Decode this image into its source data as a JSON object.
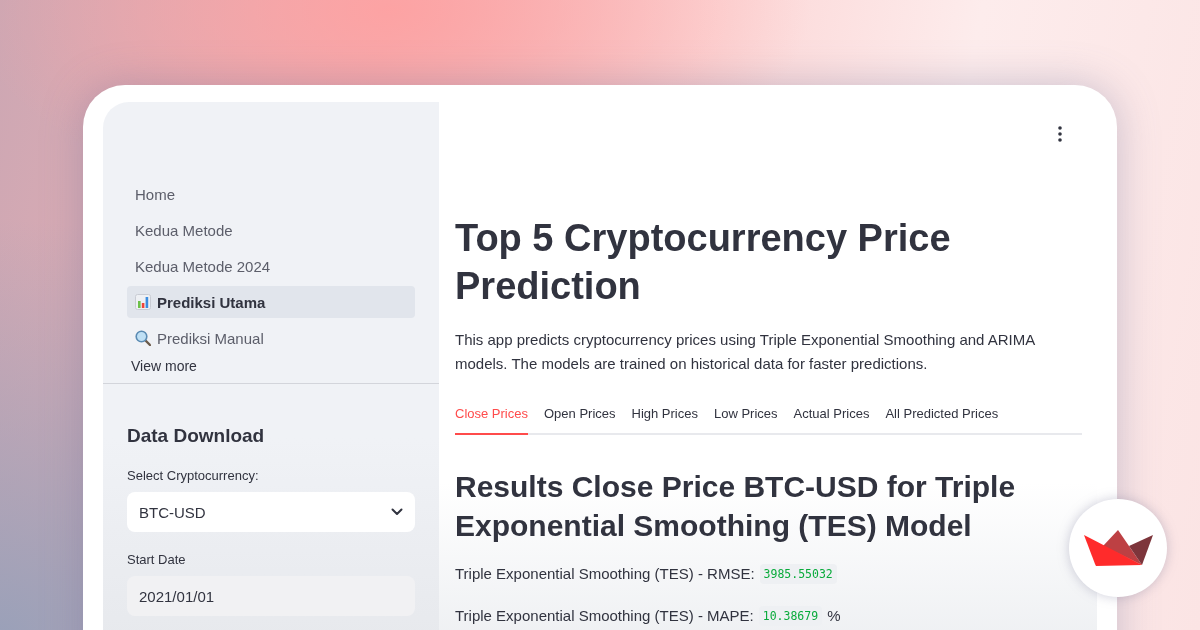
{
  "sidebar": {
    "nav_items": [
      {
        "label": "Home",
        "kind": "plain",
        "selected": false
      },
      {
        "label": "Kedua Metode",
        "kind": "plain",
        "selected": false
      },
      {
        "label": "Kedua Metode 2024",
        "kind": "plain",
        "selected": false
      },
      {
        "label": "Prediksi Utama",
        "kind": "chart",
        "selected": true
      },
      {
        "label": "Prediksi Manual",
        "kind": "search",
        "selected": false
      }
    ],
    "view_more": "View more",
    "section_title": "Data Download",
    "fields": [
      {
        "kind": "select",
        "label": "Select Cryptocurrency:",
        "value": "BTC-USD"
      },
      {
        "kind": "date",
        "label": "Start Date",
        "value": "2021/01/01"
      }
    ]
  },
  "main": {
    "title": "Top 5 Cryptocurrency Price Prediction",
    "description": "This app predicts cryptocurrency prices using Triple Exponential Smoothing and ARIMA models. The models are trained on historical data for faster predictions.",
    "tabs": [
      {
        "label": "Close Prices",
        "selected": true
      },
      {
        "label": "Open Prices",
        "selected": false
      },
      {
        "label": "High Prices",
        "selected": false
      },
      {
        "label": "Low Prices",
        "selected": false
      },
      {
        "label": "Actual Prices",
        "selected": false
      },
      {
        "label": "All Predicted Prices",
        "selected": false
      }
    ],
    "result_heading": "Results Close Price BTC-USD for Triple Exponential Smoothing (TES) Model",
    "metrics": [
      {
        "label": "Triple Exponential Smoothing (TES) - RMSE:",
        "value": "3985.55032"
      },
      {
        "label": "Triple Exponential Smoothing (TES) - MAPE:",
        "value": "10.38679",
        "unit": "%"
      }
    ]
  }
}
